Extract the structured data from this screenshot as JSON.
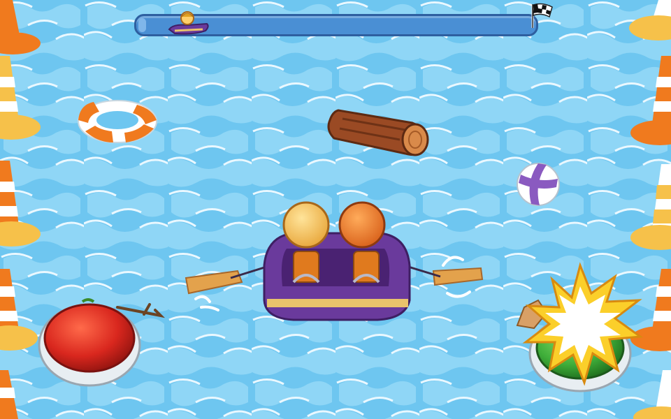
{
  "hud": {
    "progress_fraction": 0.02,
    "finish_flag_icon": "checkered-flag-icon",
    "progress_marker_icon": "boat-marker-icon"
  },
  "controls": {
    "left_button_icon": "red-round-button-icon",
    "right_button_icon": "green-round-button-icon",
    "burst_icon": "explosion-burst-icon"
  },
  "colors": {
    "water": "#6ec6f0",
    "water_light": "#a9e3fb",
    "progress_track": "#4a8fd4",
    "boat_purple": "#6a3a9c",
    "button_red": "#d9271e",
    "button_green": "#3fae3a",
    "cone_orange": "#f07a1e",
    "cone_yellow": "#f6c14a"
  },
  "objects": {
    "life_ring_icon": "life-ring-icon",
    "log_icon": "floating-log-icon",
    "beach_ball_icon": "beach-ball-icon",
    "raft_icon": "raft-icon"
  }
}
